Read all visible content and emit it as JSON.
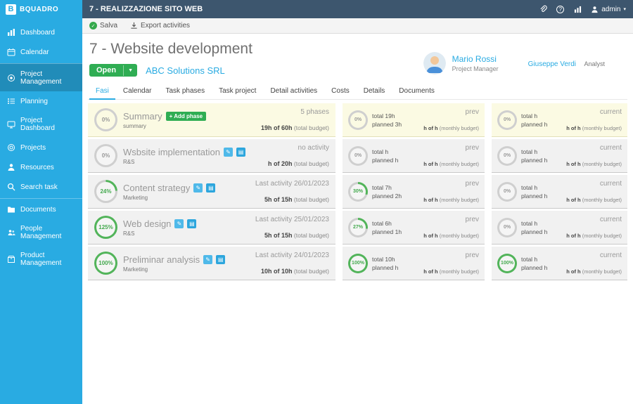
{
  "colors": {
    "accent": "#29abe2",
    "topbar": "#3d566e",
    "green": "#2fad53",
    "highlight_row": "#fbfae3"
  },
  "topbar": {
    "logo_letter": "B",
    "logo_text": "BQUADRO",
    "title": "7 - REALIZZAZIONE SITO WEB",
    "user": "admin"
  },
  "sidebar": {
    "items": [
      {
        "label": "Dashboard"
      },
      {
        "label": "Calendar"
      },
      {
        "label": "Project Management"
      },
      {
        "label": "Planning"
      },
      {
        "label": "Project Dashboard"
      },
      {
        "label": "Projects"
      },
      {
        "label": "Resources"
      },
      {
        "label": "Search task"
      },
      {
        "label": "Documents"
      },
      {
        "label": "People Management"
      },
      {
        "label": "Product Management"
      }
    ]
  },
  "toolbar": {
    "save_label": "Salva",
    "export_label": "Export activities"
  },
  "header": {
    "title": "7 - Website development",
    "status_label": "Open",
    "customer": "ABC Solutions SRL",
    "pm_name": "Mario Rossi",
    "pm_role": "Project Manager",
    "analyst_name": "Giuseppe Verdi",
    "analyst_role": "Analyst"
  },
  "tabs": [
    {
      "label": "Fasi"
    },
    {
      "label": "Calendar"
    },
    {
      "label": "Task phases"
    },
    {
      "label": "Task project"
    },
    {
      "label": "Detail activities"
    },
    {
      "label": "Costs"
    },
    {
      "label": "Details"
    },
    {
      "label": "Documents"
    }
  ],
  "add_phase_label": "+ Add phase",
  "phases": [
    {
      "pct": "0%",
      "fill": 0,
      "name": "Summary",
      "subtitle": "summary",
      "activity": "5 phases",
      "budget_hours": "19h of 60h",
      "budget_label": "(total budget)",
      "prev": {
        "pct": "0%",
        "fill": 0,
        "total": "total 19h",
        "planned": "planned 3h",
        "label": "prev",
        "monthly_hours": "h of h",
        "monthly_label": "(monthly budget)"
      },
      "current": {
        "pct": "0%",
        "fill": 0,
        "total": "total h",
        "planned": "planned h",
        "label": "current",
        "monthly_hours": "h of h",
        "monthly_label": "(monthly budget)"
      }
    },
    {
      "pct": "0%",
      "fill": 0,
      "name": "Wsbsite implementation",
      "subtitle": "R&S",
      "activity": "no activity",
      "budget_hours": "h of 20h",
      "budget_label": "(total budget)",
      "prev": {
        "pct": "0%",
        "fill": 0,
        "total": "total h",
        "planned": "planned h",
        "label": "prev",
        "monthly_hours": "h of h",
        "monthly_label": "(monthly budget)"
      },
      "current": {
        "pct": "0%",
        "fill": 0,
        "total": "total h",
        "planned": "planned h",
        "label": "current",
        "monthly_hours": "h of h",
        "monthly_label": "(monthly budget)"
      }
    },
    {
      "pct": "24%",
      "fill": 24,
      "name": "Content strategy",
      "subtitle": "Marketing",
      "activity": "Last activity 26/01/2023",
      "budget_hours": "5h of 15h",
      "budget_label": "(total budget)",
      "prev": {
        "pct": "30%",
        "fill": 30,
        "total": "total 7h",
        "planned": "planned 2h",
        "label": "prev",
        "monthly_hours": "h of h",
        "monthly_label": "(monthly budget)"
      },
      "current": {
        "pct": "0%",
        "fill": 0,
        "total": "total h",
        "planned": "planned h",
        "label": "current",
        "monthly_hours": "h of h",
        "monthly_label": "(monthly budget)"
      }
    },
    {
      "pct": "125%",
      "fill": 125,
      "name": "Web design",
      "subtitle": "R&S",
      "activity": "Last activity 25/01/2023",
      "budget_hours": "5h of 15h",
      "budget_label": "(total budget)",
      "prev": {
        "pct": "27%",
        "fill": 27,
        "total": "total 6h",
        "planned": "planned 1h",
        "label": "prev",
        "monthly_hours": "h of h",
        "monthly_label": "(monthly budget)"
      },
      "current": {
        "pct": "0%",
        "fill": 0,
        "total": "total h",
        "planned": "planned h",
        "label": "current",
        "monthly_hours": "h of h",
        "monthly_label": "(monthly budget)"
      }
    },
    {
      "pct": "100%",
      "fill": 100,
      "name": "Preliminar analysis",
      "subtitle": "Marketing",
      "activity": "Last activity 24/01/2023",
      "budget_hours": "10h of 10h",
      "budget_label": "(total budget)",
      "prev": {
        "pct": "100%",
        "fill": 100,
        "total": "total 10h",
        "planned": "planned h",
        "label": "prev",
        "monthly_hours": "h of h",
        "monthly_label": "(monthly budget)"
      },
      "current": {
        "pct": "100%",
        "fill": 100,
        "total": "total h",
        "planned": "planned h",
        "label": "current",
        "monthly_hours": "h of h",
        "monthly_label": "(monthly budget)"
      }
    }
  ]
}
